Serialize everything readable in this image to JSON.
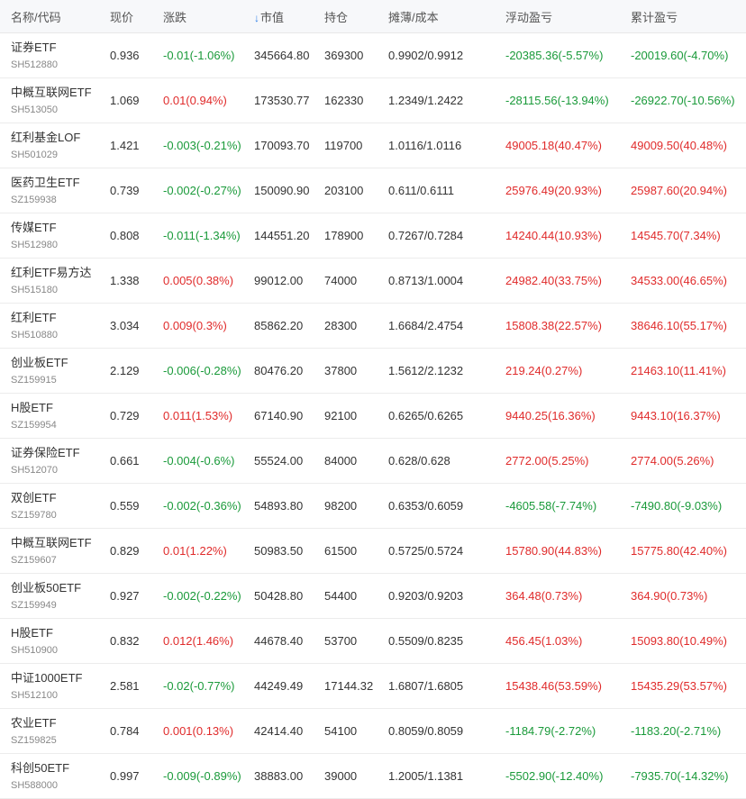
{
  "header": {
    "name_code": "名称/代码",
    "price": "现价",
    "change": "涨跌",
    "market_value": "市值",
    "position": "持仓",
    "cost": "摊薄/成本",
    "float_pl": "浮动盈亏",
    "accum_pl": "累计盈亏",
    "sort_arrow": "↓"
  },
  "colors": {
    "up": "#e02b2b",
    "down": "#1a9a3a"
  },
  "rows": [
    {
      "name": "证券ETF",
      "code": "SH512880",
      "price": "0.936",
      "change": "-0.01(-1.06%)",
      "change_dir": "down",
      "mv": "345664.80",
      "pos": "369300",
      "cost": "0.9902/0.9912",
      "float": "-20385.36(-5.57%)",
      "float_dir": "down",
      "accum": "-20019.60(-4.70%)",
      "accum_dir": "down"
    },
    {
      "name": "中概互联网ETF",
      "code": "SH513050",
      "price": "1.069",
      "change": "0.01(0.94%)",
      "change_dir": "up",
      "mv": "173530.77",
      "pos": "162330",
      "cost": "1.2349/1.2422",
      "float": "-28115.56(-13.94%)",
      "float_dir": "down",
      "accum": "-26922.70(-10.56%)",
      "accum_dir": "down"
    },
    {
      "name": "红利基金LOF",
      "code": "SH501029",
      "price": "1.421",
      "change": "-0.003(-0.21%)",
      "change_dir": "down",
      "mv": "170093.70",
      "pos": "119700",
      "cost": "1.0116/1.0116",
      "float": "49005.18(40.47%)",
      "float_dir": "up",
      "accum": "49009.50(40.48%)",
      "accum_dir": "up"
    },
    {
      "name": "医药卫生ETF",
      "code": "SZ159938",
      "price": "0.739",
      "change": "-0.002(-0.27%)",
      "change_dir": "down",
      "mv": "150090.90",
      "pos": "203100",
      "cost": "0.611/0.6111",
      "float": "25976.49(20.93%)",
      "float_dir": "up",
      "accum": "25987.60(20.94%)",
      "accum_dir": "up"
    },
    {
      "name": "传媒ETF",
      "code": "SH512980",
      "price": "0.808",
      "change": "-0.011(-1.34%)",
      "change_dir": "down",
      "mv": "144551.20",
      "pos": "178900",
      "cost": "0.7267/0.7284",
      "float": "14240.44(10.93%)",
      "float_dir": "up",
      "accum": "14545.70(7.34%)",
      "accum_dir": "up"
    },
    {
      "name": "红利ETF易方达",
      "code": "SH515180",
      "price": "1.338",
      "change": "0.005(0.38%)",
      "change_dir": "up",
      "mv": "99012.00",
      "pos": "74000",
      "cost": "0.8713/1.0004",
      "float": "24982.40(33.75%)",
      "float_dir": "up",
      "accum": "34533.00(46.65%)",
      "accum_dir": "up"
    },
    {
      "name": "红利ETF",
      "code": "SH510880",
      "price": "3.034",
      "change": "0.009(0.3%)",
      "change_dir": "up",
      "mv": "85862.20",
      "pos": "28300",
      "cost": "1.6684/2.4754",
      "float": "15808.38(22.57%)",
      "float_dir": "up",
      "accum": "38646.10(55.17%)",
      "accum_dir": "up"
    },
    {
      "name": "创业板ETF",
      "code": "SZ159915",
      "price": "2.129",
      "change": "-0.006(-0.28%)",
      "change_dir": "down",
      "mv": "80476.20",
      "pos": "37800",
      "cost": "1.5612/2.1232",
      "float": "219.24(0.27%)",
      "float_dir": "up",
      "accum": "21463.10(11.41%)",
      "accum_dir": "up"
    },
    {
      "name": "H股ETF",
      "code": "SZ159954",
      "price": "0.729",
      "change": "0.011(1.53%)",
      "change_dir": "up",
      "mv": "67140.90",
      "pos": "92100",
      "cost": "0.6265/0.6265",
      "float": "9440.25(16.36%)",
      "float_dir": "up",
      "accum": "9443.10(16.37%)",
      "accum_dir": "up"
    },
    {
      "name": "证券保险ETF",
      "code": "SH512070",
      "price": "0.661",
      "change": "-0.004(-0.6%)",
      "change_dir": "down",
      "mv": "55524.00",
      "pos": "84000",
      "cost": "0.628/0.628",
      "float": "2772.00(5.25%)",
      "float_dir": "up",
      "accum": "2774.00(5.26%)",
      "accum_dir": "up"
    },
    {
      "name": "双创ETF",
      "code": "SZ159780",
      "price": "0.559",
      "change": "-0.002(-0.36%)",
      "change_dir": "down",
      "mv": "54893.80",
      "pos": "98200",
      "cost": "0.6353/0.6059",
      "float": "-4605.58(-7.74%)",
      "float_dir": "down",
      "accum": "-7490.80(-9.03%)",
      "accum_dir": "down"
    },
    {
      "name": "中概互联网ETF",
      "code": "SZ159607",
      "price": "0.829",
      "change": "0.01(1.22%)",
      "change_dir": "up",
      "mv": "50983.50",
      "pos": "61500",
      "cost": "0.5725/0.5724",
      "float": "15780.90(44.83%)",
      "float_dir": "up",
      "accum": "15775.80(42.40%)",
      "accum_dir": "up"
    },
    {
      "name": "创业板50ETF",
      "code": "SZ159949",
      "price": "0.927",
      "change": "-0.002(-0.22%)",
      "change_dir": "down",
      "mv": "50428.80",
      "pos": "54400",
      "cost": "0.9203/0.9203",
      "float": "364.48(0.73%)",
      "float_dir": "up",
      "accum": "364.90(0.73%)",
      "accum_dir": "up"
    },
    {
      "name": "H股ETF",
      "code": "SH510900",
      "price": "0.832",
      "change": "0.012(1.46%)",
      "change_dir": "up",
      "mv": "44678.40",
      "pos": "53700",
      "cost": "0.5509/0.8235",
      "float": "456.45(1.03%)",
      "float_dir": "up",
      "accum": "15093.80(10.49%)",
      "accum_dir": "up"
    },
    {
      "name": "中证1000ETF",
      "code": "SH512100",
      "price": "2.581",
      "change": "-0.02(-0.77%)",
      "change_dir": "down",
      "mv": "44249.49",
      "pos": "17144.32",
      "cost": "1.6807/1.6805",
      "float": "15438.46(53.59%)",
      "float_dir": "up",
      "accum": "15435.29(53.57%)",
      "accum_dir": "up"
    },
    {
      "name": "农业ETF",
      "code": "SZ159825",
      "price": "0.784",
      "change": "0.001(0.13%)",
      "change_dir": "up",
      "mv": "42414.40",
      "pos": "54100",
      "cost": "0.8059/0.8059",
      "float": "-1184.79(-2.72%)",
      "float_dir": "down",
      "accum": "-1183.20(-2.71%)",
      "accum_dir": "down"
    },
    {
      "name": "科创50ETF",
      "code": "SH588000",
      "price": "0.997",
      "change": "-0.009(-0.89%)",
      "change_dir": "down",
      "mv": "38883.00",
      "pos": "39000",
      "cost": "1.2005/1.1381",
      "float": "-5502.90(-12.40%)",
      "float_dir": "down",
      "accum": "-7935.70(-14.32%)",
      "accum_dir": "down"
    }
  ]
}
